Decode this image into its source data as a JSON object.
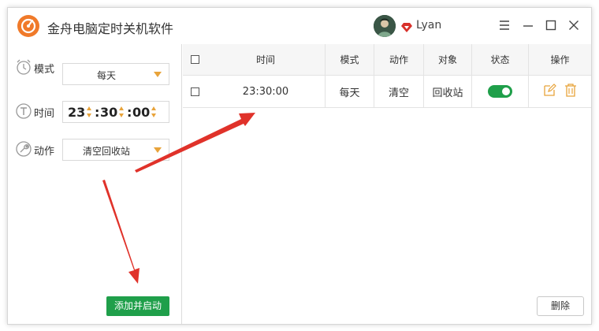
{
  "app": {
    "title": "金舟电脑定时关机软件",
    "user_name": "Lyan"
  },
  "form": {
    "mode_label": "模式",
    "mode_value": "每天",
    "time_label": "时间",
    "time_hour": "23",
    "time_minute": "30",
    "time_second": "00",
    "time_sep": ":",
    "action_label": "动作",
    "action_value": "清空回收站",
    "add_button": "添加并启动"
  },
  "table": {
    "headers": [
      "时间",
      "模式",
      "动作",
      "对象",
      "状态",
      "操作"
    ],
    "rows": [
      {
        "time": "23:30:00",
        "mode": "每天",
        "action": "清空",
        "target": "回收站",
        "enabled": true
      }
    ]
  },
  "delete_button": "删除",
  "colors": {
    "accent_green": "#1f9f4a",
    "accent_orange": "#e8a33a",
    "annotation_red": "#e0322a",
    "logo_orange": "#f07a2a"
  }
}
